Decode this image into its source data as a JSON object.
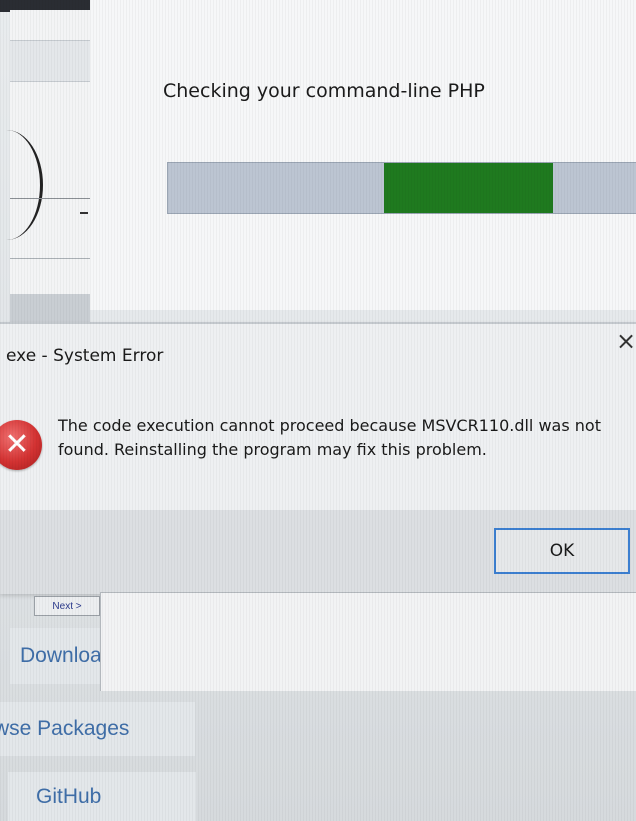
{
  "installer": {
    "status_text": "Checking your command-line PHP",
    "progress": {
      "indeterminate": true,
      "segment_start_fraction": 0.46,
      "segment_end_fraction": 0.82,
      "track_color": "#bcc5d2",
      "fill_color": "#1f7a1f"
    },
    "next_label": "Next >"
  },
  "dialog": {
    "title": "exe - System Error",
    "message": "The code execution cannot proceed because MSVCR110.dll was not found. Reinstalling the program may fix this problem.",
    "ok_label": "OK",
    "close_glyph": "×",
    "icon": "error-icon",
    "icon_glyph": "✕",
    "accent_color": "#3c7fd0",
    "error_color": "#d33232"
  },
  "website_nav": {
    "items": [
      {
        "label": "Downloa"
      },
      {
        "label": "wse Packages"
      },
      {
        "label": "GitHub"
      }
    ],
    "link_color": "#3f6ea8"
  }
}
